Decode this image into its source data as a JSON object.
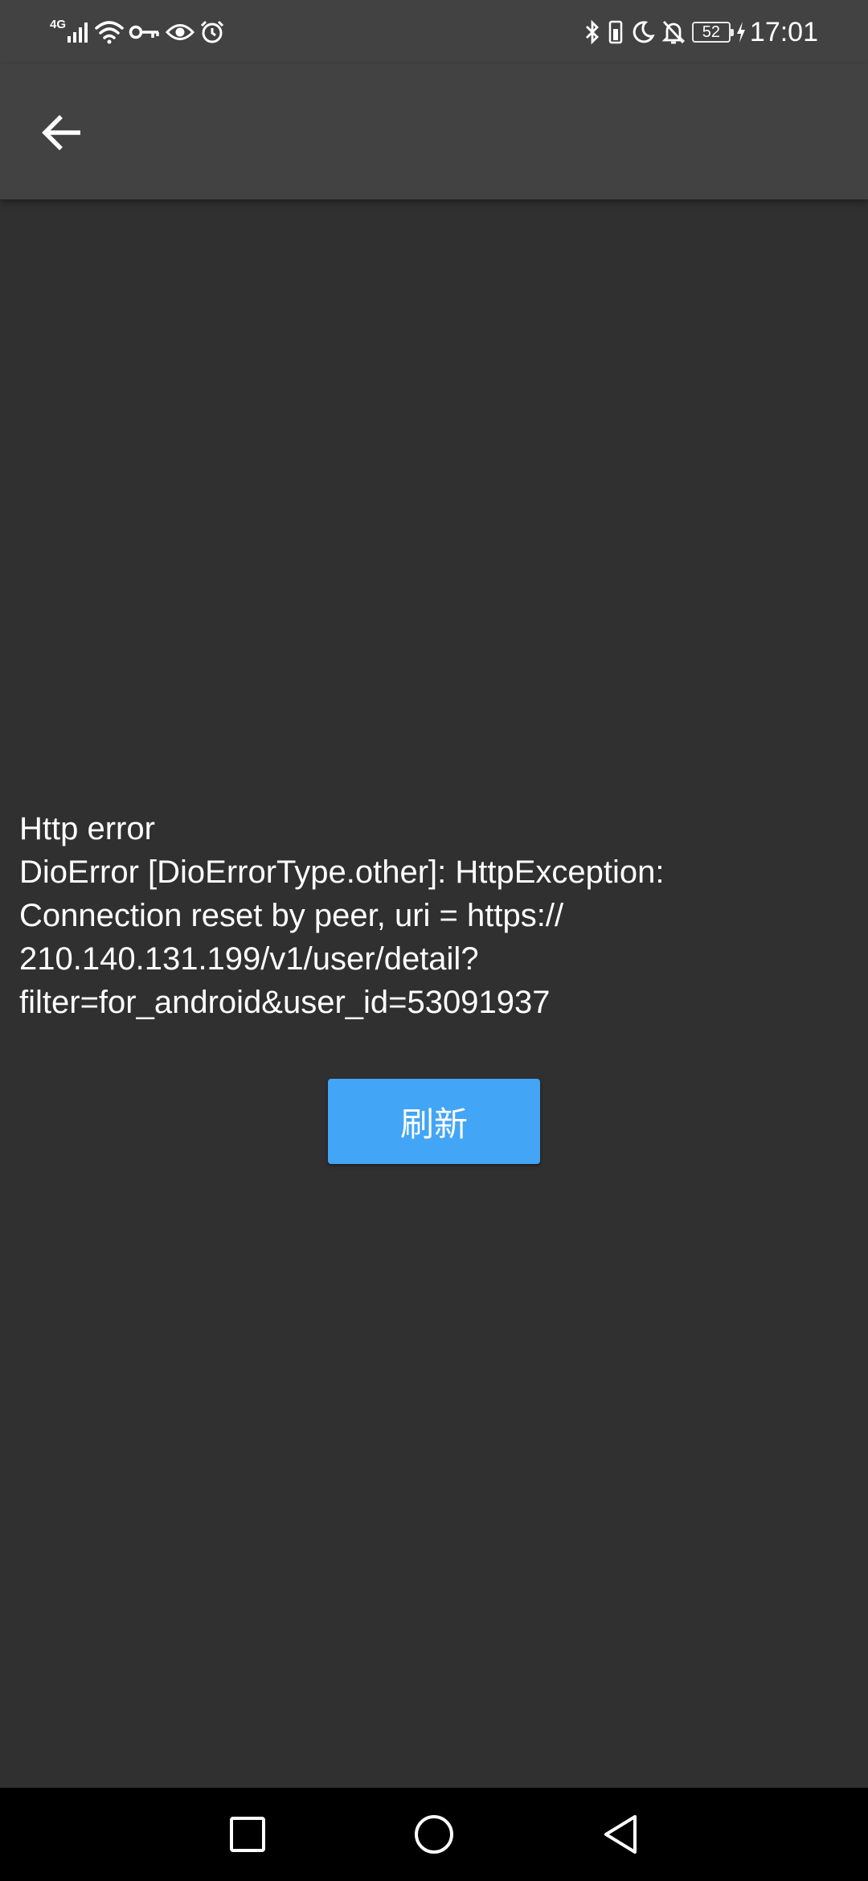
{
  "status_bar": {
    "network_type": "4G",
    "time": "17:01",
    "battery_level": "52",
    "icons_left": [
      "signal-icon",
      "wifi-icon",
      "vpn-key-icon",
      "eye-icon",
      "alarm-icon"
    ],
    "icons_right": [
      "bluetooth-icon",
      "battery-vibrate-icon",
      "moon-icon",
      "bell-off-icon",
      "battery-icon",
      "charging-icon"
    ]
  },
  "app_bar": {
    "back_icon": "arrow-left-icon"
  },
  "error": {
    "title": "Http error",
    "lines": [
      "DioError [DioErrorType.other]: HttpException:",
      "Connection reset by peer, uri = https://",
      "210.140.131.199/v1/user/detail?",
      "filter=for_android&user_id=53091937"
    ]
  },
  "refresh_button": {
    "label": "刷新",
    "color": "#42a5f5"
  },
  "nav_bar": {
    "icons": [
      "square-recents-icon",
      "circle-home-icon",
      "triangle-back-icon"
    ]
  },
  "colors": {
    "background": "#303030",
    "app_bar": "#424242",
    "nav_bar": "#000000"
  }
}
